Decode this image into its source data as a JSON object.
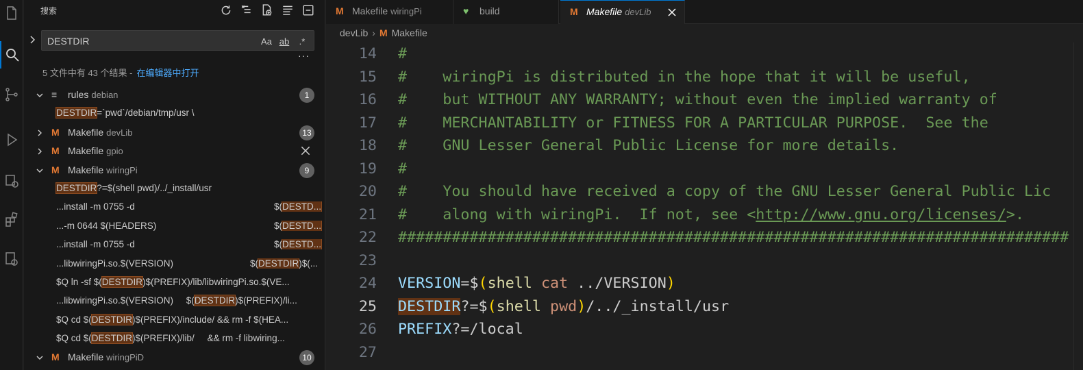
{
  "sidebar": {
    "title": "搜索",
    "search_value": "DESTDIR",
    "opt_case": "Aa",
    "opt_word": "ab",
    "opt_regex": ".*",
    "summary": "5 文件中有 43 个结果 -",
    "open_in_editor": "在编辑器中打开",
    "groups": [
      {
        "name": "rules",
        "dir": "debian",
        "count": "1"
      },
      {
        "name": "Makefile",
        "dir": "devLib",
        "count": "13"
      },
      {
        "name": "Makefile",
        "dir": "gpio",
        "count": ""
      },
      {
        "name": "Makefile",
        "dir": "wiringPi",
        "count": "9"
      },
      {
        "name": "Makefile",
        "dir": "wiringPiD",
        "count": "10"
      }
    ],
    "rules_match": {
      "hl": "DESTDIR",
      "rest": "=`pwd`/debian/tmp/usr \\"
    },
    "wp_matches": [
      {
        "pre": "",
        "hl": "DESTDIR",
        "post": "?=$(shell pwd)/../_install/usr"
      },
      {
        "left": "...install -m 0755 -d",
        "rpre": "$(",
        "rhl": "DESTD...",
        "rpost": ""
      },
      {
        "left": "...-m 0644 $(HEADERS)",
        "rpre": "$(",
        "rhl": "DESTD...",
        "rpost": ""
      },
      {
        "left": "...install -m 0755 -d",
        "rpre": "$(",
        "rhl": "DESTD...",
        "rpost": ""
      },
      {
        "left": "...libwiringPi.so.$(VERSION)",
        "rpre": "$(",
        "rhl": "DESTDIR",
        "rpost": ")$(..."
      },
      {
        "pre": "$Q ln -sf $(",
        "hl": "DESTDIR",
        "post": ")$(PREFIX)/lib/libwiringPi.so.$(VE..."
      },
      {
        "pre": "...libwiringPi.so.$(VERSION)     $(",
        "hl": "DESTDIR",
        "post": ")$(PREFIX)/li..."
      },
      {
        "pre": "$Q cd $(",
        "hl": "DESTDIR",
        "post": ")$(PREFIX)/include/ && rm -f $(HEA..."
      },
      {
        "pre": "$Q cd $(",
        "hl": "DESTDIR",
        "post": ")$(PREFIX)/lib/     && rm -f libwiring..."
      }
    ]
  },
  "tabs": [
    {
      "icon": "M",
      "label": "Makefile",
      "dir": "wiringPi"
    },
    {
      "icon": "heart",
      "label": "build",
      "dir": ""
    },
    {
      "icon": "M",
      "label": "Makefile",
      "dir": "devLib"
    }
  ],
  "breadcrumb": {
    "folder": "devLib",
    "file": "Makefile"
  },
  "code": {
    "line_numbers": [
      "14",
      "15",
      "16",
      "17",
      "18",
      "19",
      "20",
      "21",
      "22",
      "23",
      "24",
      "25",
      "26",
      "27"
    ],
    "comment_lines": [
      "#",
      "#    wiringPi is distributed in the hope that it will be useful,",
      "#    but WITHOUT ANY WARRANTY; without even the implied warranty of",
      "#    MERCHANTABILITY or FITNESS FOR A PARTICULAR PURPOSE.  See the",
      "#    GNU Lesser General Public License for more details.",
      "#",
      "#    You should have received a copy of the GNU Lesser General Public Lic",
      "#    along with wiringPi.  If not, see <",
      "###########################################################################"
    ],
    "url": "http://www.gnu.org/licenses/",
    "url_tail": ">.",
    "l24": {
      "var": "VERSION",
      "op": "=",
      "dol": "$",
      "po": "(",
      "fn": "shell",
      "arg": "cat",
      "rest": " ../VERSION",
      "pc": ")"
    },
    "l25": {
      "var": "DESTDIR",
      "op": "?=",
      "dol": "$",
      "po": "(",
      "fn": "shell",
      "arg": "pwd",
      "pc": ")",
      "rest": "/../_install/usr"
    },
    "l26": {
      "var": "PREFIX",
      "op": "?=/local"
    }
  },
  "colors": {
    "accent": "#0078d4",
    "match_bg": "#613214",
    "make_icon": "#e37933",
    "comment": "#6a9955"
  }
}
